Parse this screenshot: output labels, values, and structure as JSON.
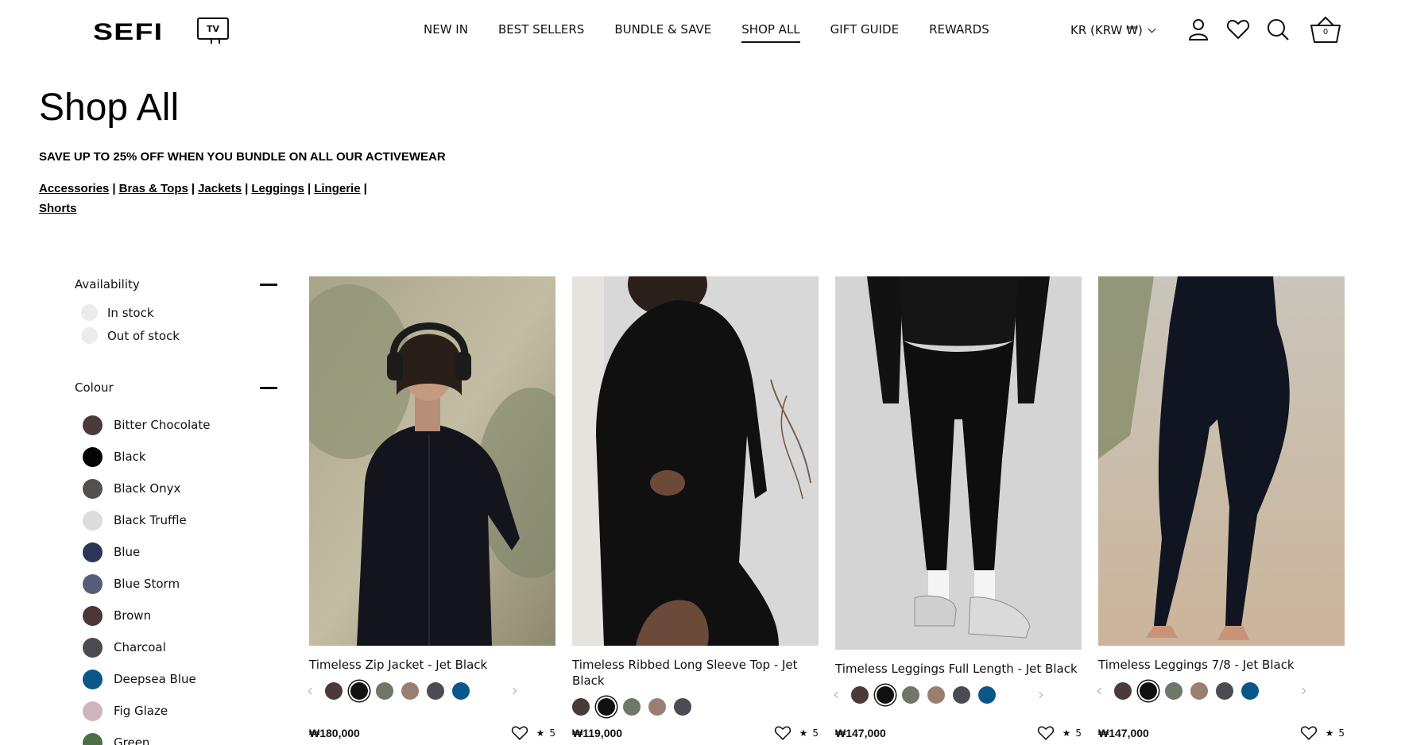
{
  "header": {
    "logo": "SEFI",
    "tv_label": "TV",
    "nav": [
      "NEW IN",
      "BEST SELLERS",
      "BUNDLE & SAVE",
      "SHOP ALL",
      "GIFT GUIDE",
      "REWARDS"
    ],
    "active_nav": "SHOP ALL",
    "currency": "KR (KRW ₩)",
    "cart_count": "0",
    "icons": [
      "account-icon",
      "wishlist-heart-icon",
      "search-icon",
      "cart-basket-icon"
    ]
  },
  "page": {
    "title": "Shop All",
    "promo": "SAVE UP TO 25% OFF WHEN YOU BUNDLE ON ALL OUR ACTIVEWEAR",
    "categories": [
      "Accessories",
      "Bras & Tops",
      "Jackets",
      "Leggings",
      "Lingerie",
      "Shorts"
    ],
    "separator": "|"
  },
  "filters": {
    "availability": {
      "label": "Availability",
      "options": [
        "In stock",
        "Out of stock"
      ]
    },
    "colour": {
      "label": "Colour",
      "options": [
        {
          "name": "Bitter Chocolate",
          "hex": "#4a3a3a"
        },
        {
          "name": "Black",
          "hex": "#050505"
        },
        {
          "name": "Black Onyx",
          "hex": "#545050"
        },
        {
          "name": "Black Truffle",
          "hex": "#dcdcdc"
        },
        {
          "name": "Blue",
          "hex": "#2c3658"
        },
        {
          "name": "Blue Storm",
          "hex": "#565d78"
        },
        {
          "name": "Brown",
          "hex": "#4b3535"
        },
        {
          "name": "Charcoal",
          "hex": "#4a4a50"
        },
        {
          "name": "Deepsea Blue",
          "hex": "#0a5688"
        },
        {
          "name": "Fig Glaze",
          "hex": "#cfb4bf"
        },
        {
          "name": "Green",
          "hex": "#4e6e46"
        }
      ]
    }
  },
  "products": [
    {
      "title": "Timeless Zip Jacket - Jet Black",
      "price": "₩180,000",
      "rating": "5",
      "swatches": [
        "#4a3a3a",
        "#111111",
        "#6e7768",
        "#9a7e72",
        "#4c4a52",
        "#0a5688"
      ],
      "selected_swatch": 1,
      "image_desc": "woman-headphones-zip-jacket"
    },
    {
      "title": "Timeless Ribbed Long Sleeve Top - Jet Black",
      "price": "₩119,000",
      "rating": "5",
      "swatches": [
        "#4a3a3a",
        "#111111",
        "#6e7768",
        "#9a7e72",
        "#4c4a52"
      ],
      "selected_swatch": 1,
      "image_desc": "woman-ribbed-top"
    },
    {
      "title": "Timeless Leggings Full Length - Jet Black",
      "price": "₩147,000",
      "rating": "5",
      "swatches": [
        "#4a3a3a",
        "#111111",
        "#6e7768",
        "#9a7e72",
        "#4c4a52",
        "#0a5688"
      ],
      "selected_swatch": 1,
      "image_desc": "leggings-sneakers"
    },
    {
      "title": "Timeless Leggings 7/8 - Jet Black",
      "price": "₩147,000",
      "rating": "5",
      "swatches": [
        "#4a3a3a",
        "#111111",
        "#6e7768",
        "#9a7e72",
        "#4c4a52",
        "#0a5688"
      ],
      "selected_swatch": 1,
      "image_desc": "leggings-barefoot-road"
    }
  ]
}
